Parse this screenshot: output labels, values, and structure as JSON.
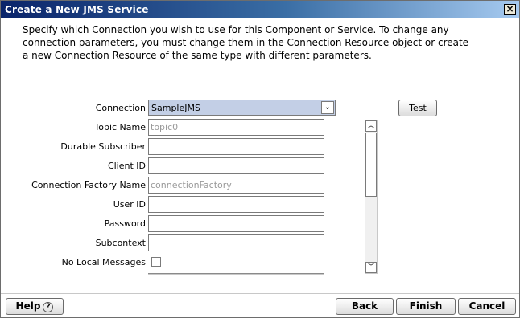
{
  "window": {
    "title": "Create a New JMS Service",
    "close_glyph": "×"
  },
  "description": "Specify which Connection you wish to use for this Component or Service.  To change any connection parameters, you must change them in the Connection Resource object or create a new Connection Resource of the same type with different parameters.",
  "form": {
    "connection": {
      "label": "Connection",
      "value": "SampleJMS"
    },
    "test_button": "Test",
    "fields": [
      {
        "label": "Topic Name",
        "value": "",
        "placeholder": "topic0"
      },
      {
        "label": "Durable Subscriber",
        "value": "",
        "placeholder": ""
      },
      {
        "label": "Client ID",
        "value": "",
        "placeholder": ""
      },
      {
        "label": "Connection Factory Name",
        "value": "",
        "placeholder": "connectionFactory"
      },
      {
        "label": "User ID",
        "value": "",
        "placeholder": ""
      },
      {
        "label": "Password",
        "value": "",
        "placeholder": ""
      },
      {
        "label": "Subcontext",
        "value": "",
        "placeholder": ""
      }
    ],
    "no_local_messages": {
      "label": "No Local Messages",
      "checked": false
    }
  },
  "buttons": {
    "help": "Help",
    "back": "Back",
    "finish": "Finish",
    "cancel": "Cancel"
  },
  "icons": {
    "help": "question-circle-icon",
    "scroll_up": "chevron-up-icon",
    "scroll_down": "chevron-down-icon",
    "dropdown": "chevron-down-icon"
  }
}
